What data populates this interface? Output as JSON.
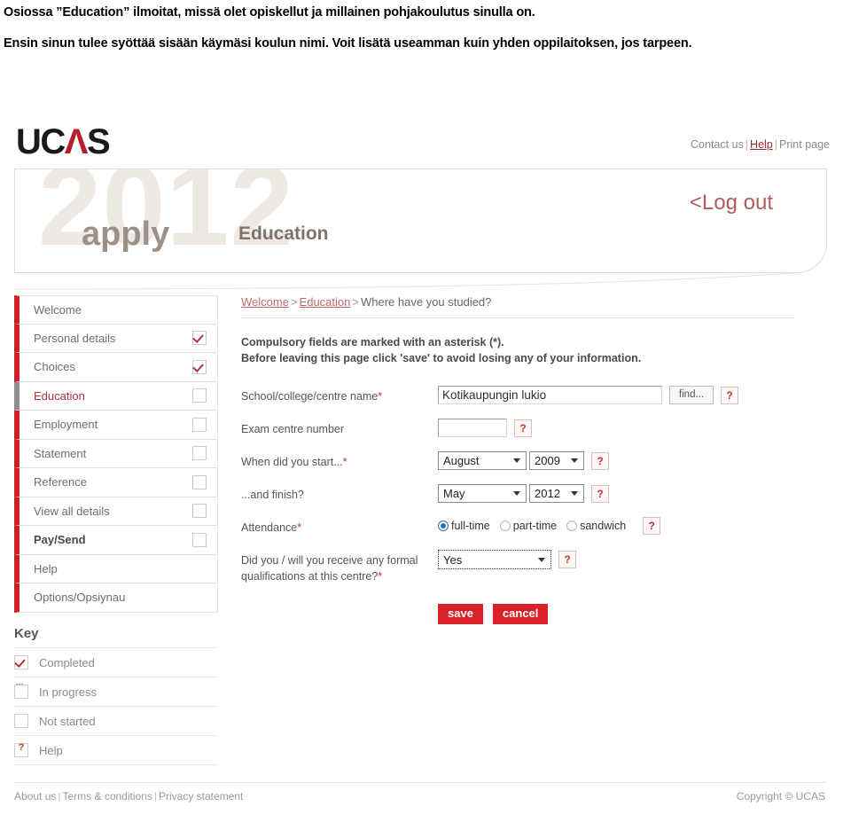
{
  "caption": {
    "paragraph1": "Osiossa ”Education” ilmoitat, missä olet opiskellut ja millainen pohjakoulutus sinulla on.",
    "paragraph2": "Ensin sinun tulee syöttää sisään käymäsi koulun nimi. Voit lisätä useamman kuin yhden oppilaitoksen, jos tarpeen."
  },
  "brand": {
    "logo_uc": "UC",
    "logo_a": "Λ",
    "logo_s": "S",
    "accent_red": "#b5202f",
    "button_red": "#d92128"
  },
  "top_links": {
    "contact": "Contact us",
    "help": "Help",
    "print": "Print page",
    "separator": "|"
  },
  "banner": {
    "year": "2012",
    "apply": "apply",
    "section": "Education",
    "logout": "<Log out"
  },
  "sidebar": {
    "items": [
      {
        "label": "Welcome",
        "state": "none",
        "active": false,
        "bold": false
      },
      {
        "label": "Personal details",
        "state": "completed",
        "active": false,
        "bold": false
      },
      {
        "label": "Choices",
        "state": "completed",
        "active": false,
        "bold": false
      },
      {
        "label": "Education",
        "state": "not-started",
        "active": true,
        "bold": false
      },
      {
        "label": "Employment",
        "state": "not-started",
        "active": false,
        "bold": false
      },
      {
        "label": "Statement",
        "state": "not-started",
        "active": false,
        "bold": false
      },
      {
        "label": "Reference",
        "state": "not-started",
        "active": false,
        "bold": false
      },
      {
        "label": "View all details",
        "state": "not-started",
        "active": false,
        "bold": false
      },
      {
        "label": "Pay/Send",
        "state": "not-started",
        "active": false,
        "bold": true
      },
      {
        "label": "Help",
        "state": "none",
        "active": false,
        "bold": false
      },
      {
        "label": "Options/Opsiynau",
        "state": "none",
        "active": false,
        "bold": false
      }
    ]
  },
  "key": {
    "title": "Key",
    "rows": [
      {
        "label": "Completed",
        "icon": "checkbox-checked-icon"
      },
      {
        "label": "In progress",
        "icon": "checkbox-dots-icon"
      },
      {
        "label": "Not started",
        "icon": "checkbox-empty-icon"
      },
      {
        "label": "Help",
        "icon": "question-mark-icon"
      }
    ]
  },
  "breadcrumb": {
    "first": "Welcome",
    "second": "Education",
    "current": "Where have you studied?",
    "separator": ">"
  },
  "notice": {
    "line1": "Compulsory fields are marked with an asterisk (*).",
    "line2": "Before leaving this page click 'save' to avoid losing any of your information."
  },
  "form": {
    "school": {
      "label": "School/college/centre name",
      "required_mark": "*",
      "value": "Kotikaupungin lukio",
      "find_button": "find...",
      "help": "?"
    },
    "exam_centre": {
      "label": "Exam centre number",
      "value": "",
      "help": "?"
    },
    "start": {
      "label": "When did you start...",
      "required_mark": "*",
      "month": "August",
      "year": "2009",
      "help": "?"
    },
    "finish": {
      "label": "...and finish?",
      "month": "May",
      "year": "2012",
      "help": "?"
    },
    "attendance": {
      "label": "Attendance",
      "required_mark": "*",
      "options": [
        {
          "label": "full-time",
          "selected": true
        },
        {
          "label": "part-time",
          "selected": false
        },
        {
          "label": "sandwich",
          "selected": false
        }
      ],
      "help": "?"
    },
    "qualifications": {
      "label_line1": "Did you / will you receive any formal",
      "label_line2": "qualifications at this centre?",
      "required_mark": "*",
      "value": "Yes",
      "help": "?"
    },
    "actions": {
      "save": "save",
      "cancel": "cancel"
    }
  },
  "footer": {
    "about": "About us",
    "terms": "Terms & conditions",
    "privacy": "Privacy statement",
    "separator": "|",
    "copyright": "Copyright © UCAS"
  }
}
